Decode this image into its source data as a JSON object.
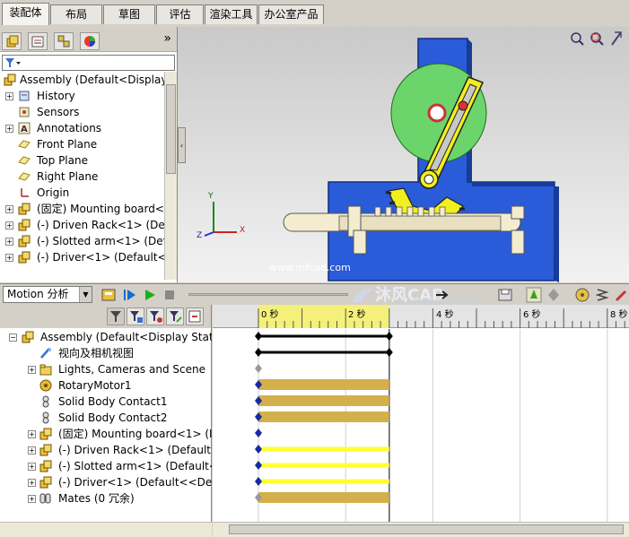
{
  "tabs": [
    {
      "label": "装配体",
      "active": true
    },
    {
      "label": "布局",
      "active": false
    },
    {
      "label": "草图",
      "active": false
    },
    {
      "label": "评估",
      "active": false
    },
    {
      "label": "渲染工具",
      "active": false
    },
    {
      "label": "办公室产品",
      "active": false
    }
  ],
  "feature_tree": {
    "expand_label": "»",
    "items": [
      {
        "label": "Assembly  (Default<Display",
        "icon": "assembly-icon",
        "expander": false
      },
      {
        "label": "History",
        "icon": "history-icon",
        "expander": true
      },
      {
        "label": "Sensors",
        "icon": "sensors-icon",
        "expander": false
      },
      {
        "label": "Annotations",
        "icon": "annotations-icon",
        "expander": true
      },
      {
        "label": "Front Plane",
        "icon": "plane-icon",
        "expander": false
      },
      {
        "label": "Top Plane",
        "icon": "plane-icon",
        "expander": false
      },
      {
        "label": "Right Plane",
        "icon": "plane-icon",
        "expander": false
      },
      {
        "label": "Origin",
        "icon": "origin-icon",
        "expander": false
      },
      {
        "label": "(固定) Mounting board<",
        "icon": "part-icon",
        "expander": true
      },
      {
        "label": "(-) Driven Rack<1> (Def",
        "icon": "part-icon",
        "expander": true
      },
      {
        "label": "(-) Slotted arm<1> (Def",
        "icon": "part-icon",
        "expander": true
      },
      {
        "label": "(-) Driver<1> (Default<<",
        "icon": "part-icon",
        "expander": true
      }
    ]
  },
  "viewport": {
    "watermark": "www.mfcad.com",
    "triad": {
      "x": "X",
      "y": "Y",
      "z": "Z"
    }
  },
  "motion": {
    "study_type": "Motion 分析",
    "brand_logo_text": "沐风CAD",
    "brand_logo_url": "www.mfcad.com",
    "tree": [
      {
        "label": "Assembly  (Default<Display State",
        "icon": "assembly-icon",
        "expander": true,
        "indent": 0
      },
      {
        "label": "视向及相机视图",
        "icon": "camera-icon",
        "expander": false,
        "indent": 1
      },
      {
        "label": "Lights, Cameras and Scene",
        "icon": "lights-folder-icon",
        "expander": true,
        "indent": 1
      },
      {
        "label": "RotaryMotor1",
        "icon": "rotary-motor-icon",
        "expander": false,
        "indent": 1
      },
      {
        "label": "Solid Body Contact1",
        "icon": "contact-icon",
        "expander": false,
        "indent": 1
      },
      {
        "label": "Solid Body Contact2",
        "icon": "contact-icon",
        "expander": false,
        "indent": 1
      },
      {
        "label": "(固定) Mounting board<1> (I",
        "icon": "part-icon",
        "expander": true,
        "indent": 1
      },
      {
        "label": "(-) Driven Rack<1> (Default<",
        "icon": "part-icon",
        "expander": true,
        "indent": 1
      },
      {
        "label": "(-) Slotted arm<1> (Default<",
        "icon": "part-icon",
        "expander": true,
        "indent": 1
      },
      {
        "label": "(-) Driver<1> (Default<<Defa",
        "icon": "part-icon",
        "expander": true,
        "indent": 1
      },
      {
        "label": "Mates (0 冗余)",
        "icon": "mates-icon",
        "expander": true,
        "indent": 1
      }
    ],
    "ruler_labels": [
      "0 秒",
      "2 秒",
      "4 秒",
      "6 秒",
      "8 秒"
    ],
    "time_bars": [
      {
        "type": "black"
      },
      {
        "type": "black"
      },
      {
        "type": "key-gray"
      },
      {
        "type": "gold"
      },
      {
        "type": "gold"
      },
      {
        "type": "gold"
      },
      {
        "type": "key-blue"
      },
      {
        "type": "yellow"
      },
      {
        "type": "yellow"
      },
      {
        "type": "yellow"
      },
      {
        "type": "gold-gray"
      }
    ]
  },
  "colors": {
    "board_blue": "#2a5bd8",
    "gear_yellow": "#f0f020",
    "disk_green": "#6bd46b",
    "gold_bar": "#d4b04c",
    "yellow_bar": "#ffff33"
  }
}
